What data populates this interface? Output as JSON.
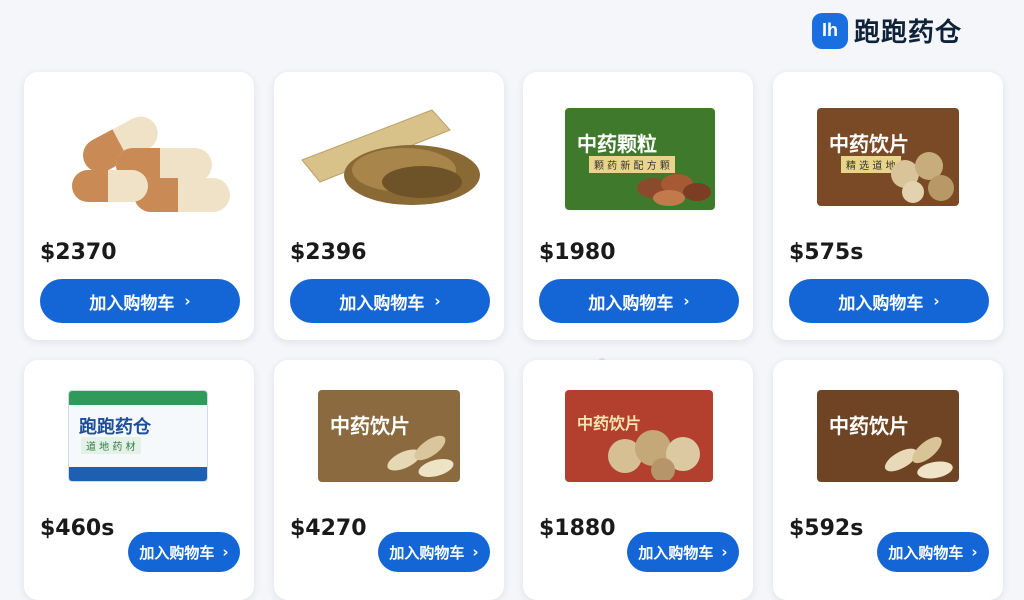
{
  "brand": {
    "logo_badge": "Ih",
    "name": "跑跑药仓"
  },
  "cart_chevron": "›",
  "products": [
    {
      "price": "$2370",
      "cart_label": "加入购物车",
      "image": "capsules"
    },
    {
      "price": "$2396",
      "cart_label": "加入购物车",
      "image": "herb-granules-sachet"
    },
    {
      "price": "$1980",
      "cart_label": "加入购物车",
      "image": "granule-box",
      "box_title": "中药颗粒",
      "box_sub": "颗 药 新 配 方 颗"
    },
    {
      "price": "$575s",
      "cart_label": "加入购物车",
      "image": "herb-slice-box",
      "box_title": "中药饮片",
      "box_sub": "精 选 道 地"
    },
    {
      "price": "$460s",
      "cart_label": "加入购物车",
      "image": "brand-box",
      "box_title": "跑跑药仓",
      "box_sub": "道 地 药 材"
    },
    {
      "price": "$4270",
      "cart_label": "加入购物车",
      "image": "herb-slice-box-2",
      "box_title": "中药饮片"
    },
    {
      "price": "$1880",
      "cart_label": "加入购物车",
      "image": "herb-slice-box-red",
      "box_title": "中药饮片"
    },
    {
      "price": "$592s",
      "cart_label": "加入购物车",
      "image": "herb-slice-box-3",
      "box_title": "中药饮片"
    }
  ]
}
